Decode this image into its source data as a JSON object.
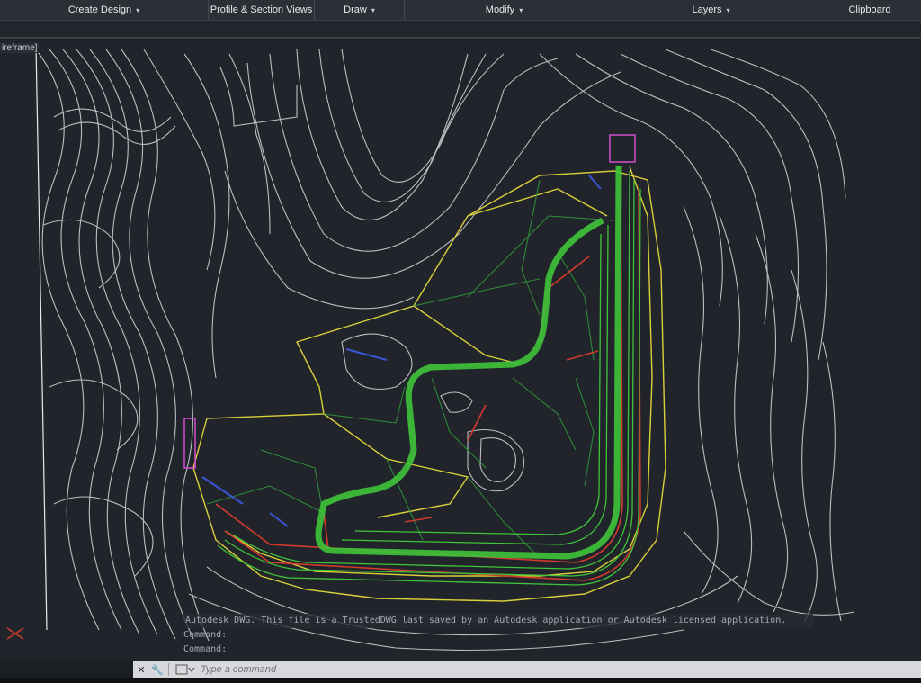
{
  "ribbon": {
    "panels": [
      {
        "label": "Create Design",
        "caret": "▾"
      },
      {
        "label": "Profile & Section Views",
        "caret": ""
      },
      {
        "label": "Draw",
        "caret": "▾"
      },
      {
        "label": "Modify",
        "caret": "▾"
      },
      {
        "label": "Layers",
        "caret": "▾"
      },
      {
        "label": "Clipboard",
        "caret": ""
      }
    ]
  },
  "viewport": {
    "label": "ireframe]"
  },
  "command": {
    "history": [
      "Autodesk DWG.  This file is a TrustedDWG last saved by an Autodesk application or Autodesk licensed application.",
      "Command:",
      "Command:"
    ],
    "placeholder": "Type a command",
    "icons": [
      "close-icon",
      "wrench-icon",
      "command-prompt-icon"
    ]
  },
  "colors": {
    "background": "#21252b",
    "contours": "#d6d9dd",
    "corridor_green": "#3fc43a",
    "offset_yellow": "#d9cf3a",
    "daylight_red": "#d33a2c",
    "link_blue": "#3a55d6",
    "marker_magenta": "#cf4fd0"
  }
}
